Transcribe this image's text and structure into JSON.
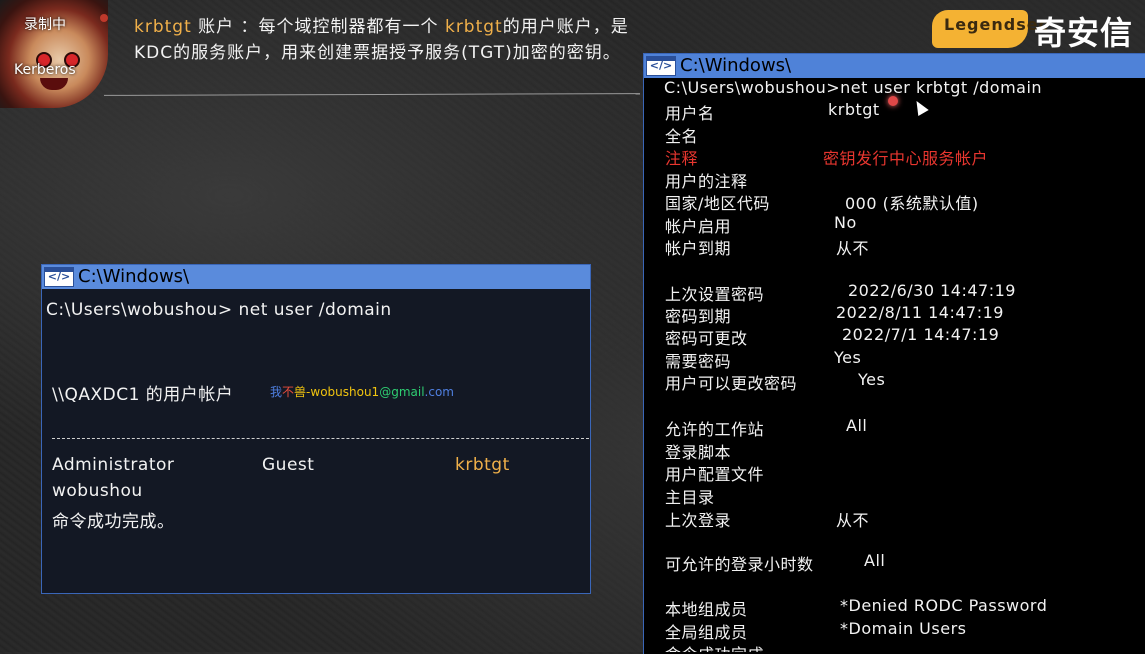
{
  "overlay": {
    "recording": "录制中",
    "avatar_caption": "Kerberos"
  },
  "intro": {
    "p1": "krbtgt",
    "p2": " 账户 ：每个域控制器都有一个 ",
    "p3": "krbtgt",
    "p4": "的用户账户，是 KDC的服务账户，用来创建票据授予服务(TGT)加密的密钥。"
  },
  "logo": {
    "mark": "Legendsec",
    "name": "奇安信"
  },
  "left_terminal": {
    "title": "C:\\Windows\\",
    "icon_text": "</>",
    "command": "C:\\Users\\wobushou>   net user /domain",
    "header": "\\\\QAXDC1  的用户帐户",
    "email_parts": [
      "我",
      "不",
      "兽",
      "-wobushou1",
      "@gmail",
      ".com"
    ],
    "accounts": [
      "Administrator",
      "Guest",
      "krbtgt",
      "wobushou"
    ],
    "done": "命令成功完成。"
  },
  "right_terminal": {
    "title": "C:\\Windows\\",
    "icon_text": "</>",
    "command": "C:\\Users\\wobushou>net user krbtgt /domain",
    "rows": [
      {
        "key": "用户名",
        "val": "krbtgt"
      },
      {
        "key": "全名",
        "val": ""
      },
      {
        "key": "注释",
        "val": "密钥发行中心服务帐户"
      },
      {
        "key": "用户的注释",
        "val": ""
      },
      {
        "key": "国家/地区代码",
        "val": "000 (系统默认值)"
      },
      {
        "key": "帐户启用",
        "val": "No"
      },
      {
        "key": "帐户到期",
        "val": "从不"
      },
      {
        "key": "上次设置密码",
        "val": "2022/6/30 14:47:19"
      },
      {
        "key": "密码到期",
        "val": "2022/8/11 14:47:19"
      },
      {
        "key": "密码可更改",
        "val": "2022/7/1 14:47:19"
      },
      {
        "key": "需要密码",
        "val": "Yes"
      },
      {
        "key": "用户可以更改密码",
        "val": "Yes"
      },
      {
        "key": "允许的工作站",
        "val": "All"
      },
      {
        "key": "登录脚本",
        "val": ""
      },
      {
        "key": "用户配置文件",
        "val": ""
      },
      {
        "key": "主目录",
        "val": ""
      },
      {
        "key": "上次登录",
        "val": "从不"
      },
      {
        "key": "可允许的登录小时数",
        "val": "All"
      },
      {
        "key": "本地组成员",
        "val": "*Denied RODC Password"
      },
      {
        "key": "全局组成员",
        "val": "*Domain Users"
      },
      {
        "key": "命令成功完成",
        "val": ""
      }
    ]
  },
  "colors": {
    "highlight": "#f0b04a",
    "error_red": "#e8362f",
    "titlebar_blue": "#4f82d8"
  }
}
